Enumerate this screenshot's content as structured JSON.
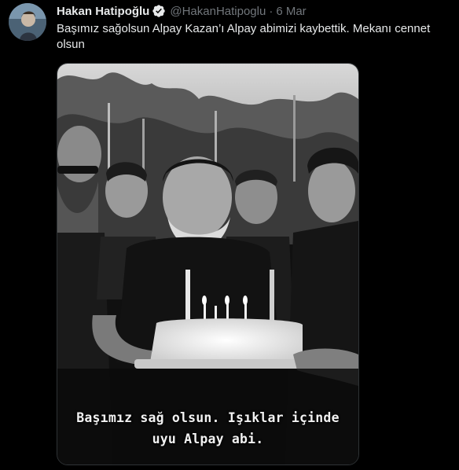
{
  "tweet": {
    "author_name": "Hakan Hatipoğlu",
    "handle": "@HakanHatipoglu",
    "separator": "·",
    "date": "6 Mar",
    "text": "Başımız sağolsun Alpay Kazan’ı Alpay abimizi kaybettik. Mekanı cennet olsun",
    "verified_icon": "verified-badge-icon"
  },
  "media": {
    "caption_line1": "Başımız sağ olsun. Işıklar içinde",
    "caption_line2": "uyu Alpay abi."
  },
  "colors": {
    "background": "#000000",
    "primary_text": "#e7e9ea",
    "secondary_text": "#71767b",
    "verified_blue": "#1d9bf0"
  }
}
